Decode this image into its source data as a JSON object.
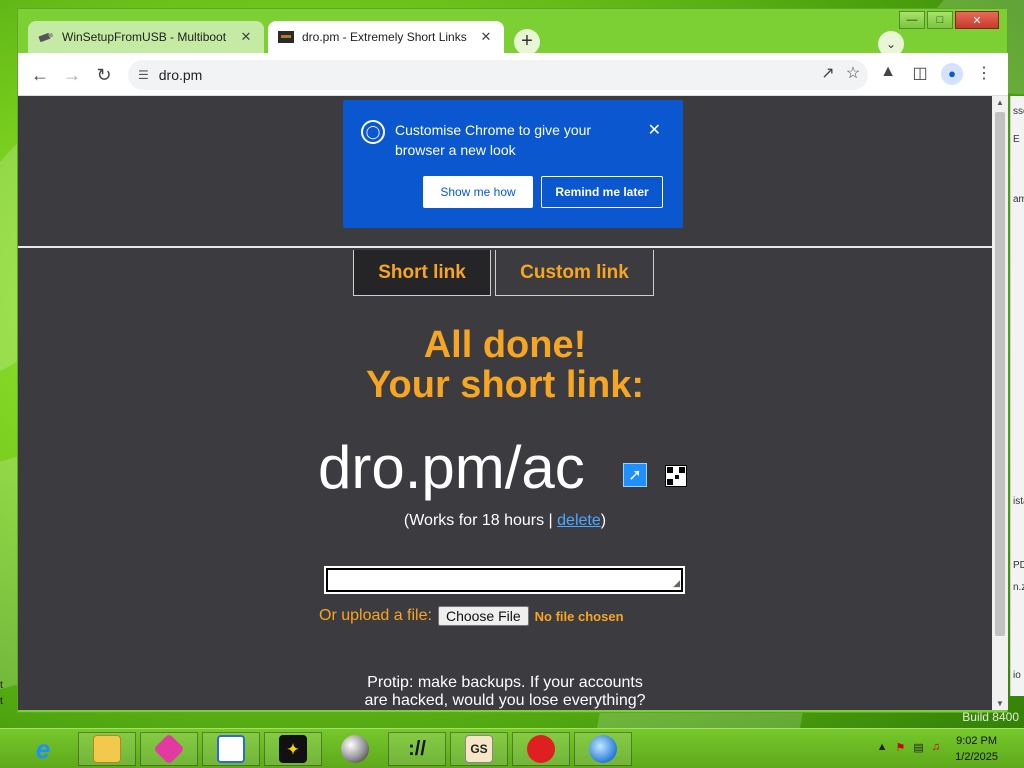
{
  "browser": {
    "tabs": [
      {
        "title": "WinSetupFromUSB - Multiboot",
        "active": false
      },
      {
        "title": "dro.pm - Extremely Short Links",
        "active": true
      }
    ],
    "new_tab": "+",
    "url": "dro.pm"
  },
  "promo": {
    "message": "Customise Chrome to give your browser a new look",
    "show_label": "Show me how",
    "later_label": "Remind me later"
  },
  "page": {
    "nav": [
      "Short link",
      "Custom link"
    ],
    "headline1": "All done!",
    "headline2": "Your short link:",
    "short_link": "dro.pm/ac",
    "works_prefix": "(Works for 18 hours | ",
    "works_link": "delete",
    "works_suffix": ")",
    "upload_label": "Or upload a file:",
    "choose_file": "Choose File",
    "no_file": "No file chosen",
    "protip": "Protip: make backups. If your accounts are hacked, would you lose everything? Download that spotify song list as .txt!"
  },
  "taskbar": {
    "time": "9:02 PM",
    "date": "1/2/2025",
    "build": "Build 8400"
  },
  "background_fragments": [
    "sse",
    "E",
    "am",
    "ista",
    "PD",
    "n.zi",
    "io"
  ],
  "desktop_fragments": [
    "t",
    "t"
  ]
}
